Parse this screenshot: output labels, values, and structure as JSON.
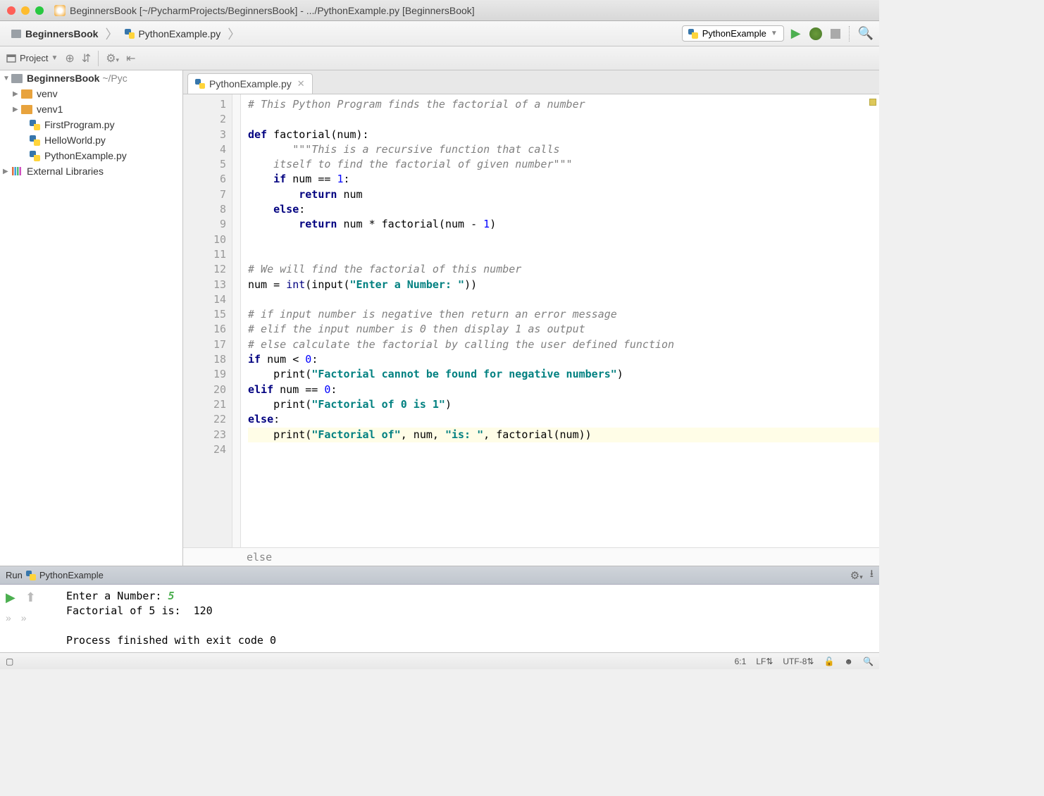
{
  "titlebar": {
    "title": "BeginnersBook [~/PycharmProjects/BeginnersBook] - .../PythonExample.py [BeginnersBook]"
  },
  "breadcrumb": {
    "root": "BeginnersBook",
    "file": "PythonExample.py"
  },
  "run_config": "PythonExample",
  "toolbar2": {
    "project_label": "Project"
  },
  "project_tree": {
    "root": "BeginnersBook",
    "root_path": "~/Pyc",
    "items": [
      "venv",
      "venv1",
      "FirstProgram.py",
      "HelloWorld.py",
      "PythonExample.py"
    ],
    "external": "External Libraries"
  },
  "tab": {
    "name": "PythonExample.py"
  },
  "gutter_lines": [
    "1",
    "2",
    "3",
    "4",
    "5",
    "6",
    "7",
    "8",
    "9",
    "10",
    "11",
    "12",
    "13",
    "14",
    "15",
    "16",
    "17",
    "18",
    "19",
    "20",
    "21",
    "22",
    "23",
    "24"
  ],
  "code": {
    "l1_comment": "# This Python Program finds the factorial of a number",
    "l3_def": "def",
    "l3_rest": " factorial(num):",
    "l4_doc": "       \"\"\"This is a recursive function that calls",
    "l5_doc": "    itself to find the factorial of given number\"\"\"",
    "l6_if": "if",
    "l6_rest": " num == ",
    "l6_num": "1",
    "l6_colon": ":",
    "l7_ret": "return",
    "l7_rest": " num",
    "l8_else": "else",
    "l8_colon": ":",
    "l9_ret": "return",
    "l9_rest": " num * factorial(num - ",
    "l9_num": "1",
    "l9_close": ")",
    "l12_comment": "# We will find the factorial of this number",
    "l13_a": "num = ",
    "l13_b": "int",
    "l13_c": "(input(",
    "l13_str": "\"Enter a Number: \"",
    "l13_d": "))",
    "l15_comment": "# if input number is negative then return an error message",
    "l16_comment": "# elif the input number is 0 then display 1 as output",
    "l17_comment": "# else calculate the factorial by calling the user defined function",
    "l18_if": "if",
    "l18_rest": " num < ",
    "l18_num": "0",
    "l18_colon": ":",
    "l19_a": "    print(",
    "l19_str": "\"Factorial cannot be found for negative numbers\"",
    "l19_b": ")",
    "l20_elif": "elif",
    "l20_rest": " num == ",
    "l20_num": "0",
    "l20_colon": ":",
    "l21_a": "    print(",
    "l21_str": "\"Factorial of 0 is 1\"",
    "l21_b": ")",
    "l22_else": "else",
    "l22_colon": ":",
    "l23_a": "    print(",
    "l23_str1": "\"Factorial of\"",
    "l23_b": ", num, ",
    "l23_str2": "\"is: \"",
    "l23_c": ", factorial(num))"
  },
  "crumb_path": "else",
  "run_panel": {
    "title": "Run",
    "config": "PythonExample",
    "out_line1a": "Enter a Number: ",
    "out_line1b": "5",
    "out_line2": "Factorial of 5 is:  120",
    "out_line3": "Process finished with exit code 0"
  },
  "statusbar": {
    "pos": "6:1",
    "lf": "LF",
    "enc": "UTF-8"
  }
}
